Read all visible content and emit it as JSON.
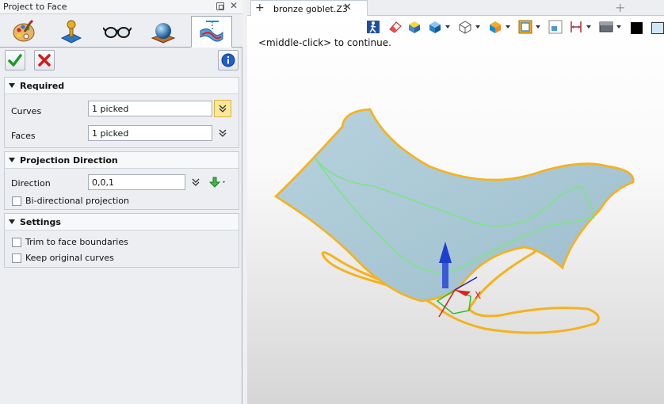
{
  "panel": {
    "title": "Project to Face",
    "close_glyph": "✕",
    "tabs": [
      {
        "name": "palette-icon",
        "active": false
      },
      {
        "name": "joystick-icon",
        "active": false
      },
      {
        "name": "glasses-icon",
        "active": false
      },
      {
        "name": "sphere-icon",
        "active": false
      },
      {
        "name": "project-to-face-icon",
        "active": true
      }
    ],
    "ok_icon": "green-check-icon",
    "cancel_icon": "red-x-icon",
    "info_icon": "info-icon"
  },
  "required": {
    "label": "Required",
    "curves_label": "Curves",
    "curves_value": "1 picked",
    "faces_label": "Faces",
    "faces_value": "1 picked"
  },
  "projection": {
    "label": "Projection Direction",
    "direction_label": "Direction",
    "direction_value": "0,0,1",
    "bidirectional_label": "Bi-directional projection"
  },
  "settings": {
    "label": "Settings",
    "trim_label": "Trim to face boundaries",
    "keep_label": "Keep original curves"
  },
  "document": {
    "tab_plus": "+",
    "tab_name": "bronze goblet.Z3",
    "tab_close": "✕",
    "new_tab": "+",
    "prompt": "<middle-click> to continue.",
    "axis_label": "X"
  },
  "colors": {
    "accent_yellow": "#fde89a",
    "curve_orange": "#f5b21c",
    "surface_blue": "#a8c8d6",
    "curve_green": "#7fe38a"
  }
}
